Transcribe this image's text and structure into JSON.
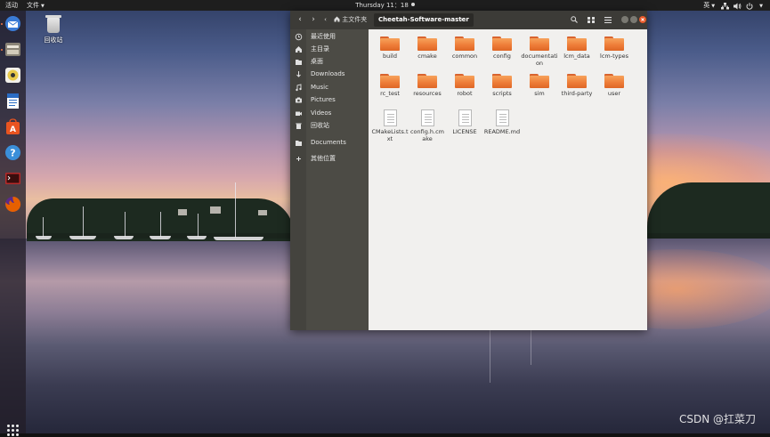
{
  "topbar": {
    "activities": "活动",
    "app_menu": "文件",
    "clock": "Thursday 11：18",
    "input_method": "英"
  },
  "desktop": {
    "trash_label": "回收站"
  },
  "dock": {
    "apps": [
      {
        "name": "thunderbird-icon",
        "color": "#3a7bd5"
      },
      {
        "name": "files-icon",
        "color": "#8a8477"
      },
      {
        "name": "rhythmbox-icon",
        "color": "#e8c94a"
      },
      {
        "name": "writer-icon",
        "color": "#2a6cc4"
      },
      {
        "name": "software-icon",
        "color": "#e95420"
      },
      {
        "name": "help-icon",
        "color": "#3b8fd9"
      },
      {
        "name": "terminal-icon",
        "color": "#b52b2b"
      },
      {
        "name": "firefox-icon",
        "color": "#e66000"
      }
    ]
  },
  "window": {
    "path_home": "主文件夹",
    "path_current": "Cheetah-Software-master",
    "sidebar": [
      {
        "label": "最近使用",
        "icon": "clock-icon"
      },
      {
        "label": "主目录",
        "icon": "home-icon"
      },
      {
        "label": "桌面",
        "icon": "folder-icon"
      },
      {
        "label": "Downloads",
        "icon": "download-icon"
      },
      {
        "label": "Music",
        "icon": "music-icon"
      },
      {
        "label": "Pictures",
        "icon": "camera-icon"
      },
      {
        "label": "Videos",
        "icon": "video-icon"
      },
      {
        "label": "回收站",
        "icon": "trash-icon"
      },
      {
        "label": "Documents",
        "icon": "folder-icon"
      },
      {
        "label": "其他位置",
        "icon": "plus-icon"
      }
    ],
    "items": [
      {
        "label": "build",
        "type": "folder"
      },
      {
        "label": "cmake",
        "type": "folder"
      },
      {
        "label": "common",
        "type": "folder"
      },
      {
        "label": "config",
        "type": "folder"
      },
      {
        "label": "documentation",
        "type": "folder"
      },
      {
        "label": "lcm_data",
        "type": "folder"
      },
      {
        "label": "lcm-types",
        "type": "folder"
      },
      {
        "label": "rc_test",
        "type": "folder"
      },
      {
        "label": "resources",
        "type": "folder"
      },
      {
        "label": "robot",
        "type": "folder"
      },
      {
        "label": "scripts",
        "type": "folder"
      },
      {
        "label": "sim",
        "type": "folder"
      },
      {
        "label": "third-party",
        "type": "folder"
      },
      {
        "label": "user",
        "type": "folder"
      },
      {
        "label": "CMakeLists.txt",
        "type": "file"
      },
      {
        "label": "config.h.cmake",
        "type": "file"
      },
      {
        "label": "LICENSE",
        "type": "file"
      },
      {
        "label": "README.md",
        "type": "file"
      }
    ]
  },
  "watermark": "CSDN @扛菜刀"
}
